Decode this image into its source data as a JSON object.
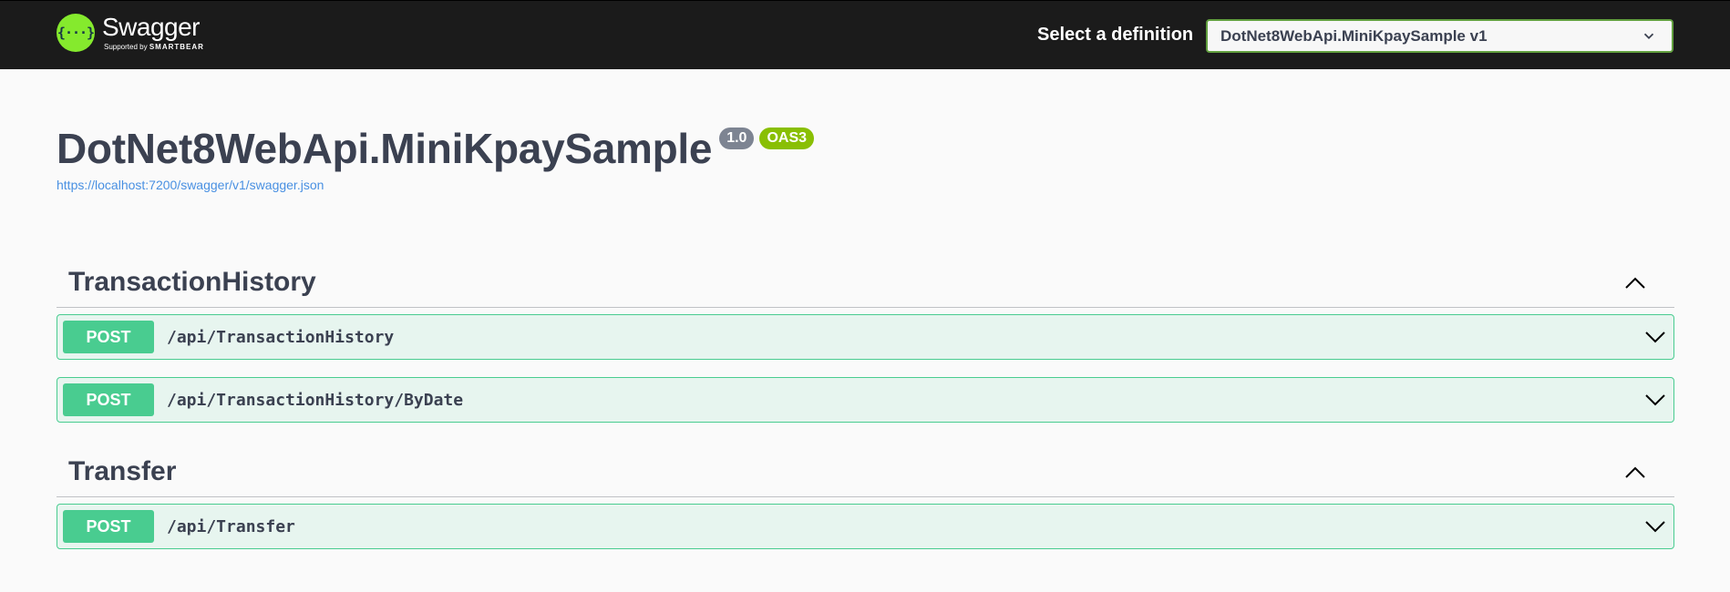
{
  "topbar": {
    "logo_badge": "{···}",
    "logo_name": "Swagger",
    "logo_sub_prefix": "Supported by",
    "logo_sub_brand": "SMARTBEAR",
    "definition_label": "Select a definition",
    "definition_selected": "DotNet8WebApi.MiniKpaySample v1"
  },
  "info": {
    "title": "DotNet8WebApi.MiniKpaySample",
    "version": "1.0",
    "oas": "OAS3",
    "spec_url": "https://localhost:7200/swagger/v1/swagger.json"
  },
  "tags": [
    {
      "name": "TransactionHistory",
      "operations": [
        {
          "method": "POST",
          "path": "/api/TransactionHistory"
        },
        {
          "method": "POST",
          "path": "/api/TransactionHistory/ByDate"
        }
      ]
    },
    {
      "name": "Transfer",
      "operations": [
        {
          "method": "POST",
          "path": "/api/Transfer"
        }
      ]
    }
  ],
  "colors": {
    "topbar_bg": "#1b1b1b",
    "post": "#49cc90",
    "logo_green": "#85ea2d",
    "version_badge": "#7d8492",
    "oas_badge": "#89bf04",
    "link": "#4990e2"
  }
}
